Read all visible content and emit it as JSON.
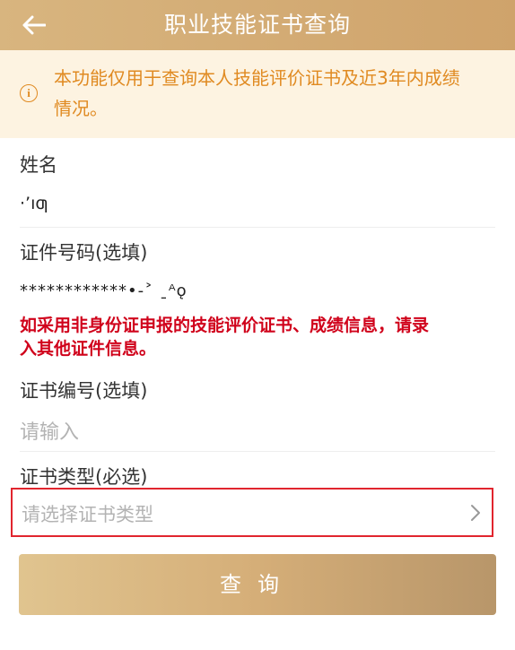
{
  "header": {
    "title": "职业技能证书查询",
    "back_icon": "arrow-left-icon"
  },
  "notice": {
    "icon": "info-circle-icon",
    "icon_glyph": "i",
    "text_line1": "本功能仅用于查询本人技能评价证书及近3年内成绩",
    "text_line2": "情况。"
  },
  "form": {
    "name_label": "姓名",
    "name_value": "·’ıƣ",
    "id_label": "证件号码(选填)",
    "id_value": "************•‐˃  ˍᴬǫ",
    "warning_line1": "如采用非身份证申报的技能评价证书、成绩信息，请录",
    "warning_line2": "入其他证件信息。",
    "cert_no_label": "证书编号(选填)",
    "cert_no_placeholder": "请输入",
    "cert_type_label": "证书类型(必选)",
    "cert_type_placeholder": "请选择证书类型",
    "chevron_icon": "chevron-right-icon"
  },
  "query_button": {
    "label": "查询"
  },
  "colors": {
    "header": "#d2a86f",
    "notice_bg": "#fdf3e1",
    "notice_text": "#e08a21",
    "warning": "#d0021b",
    "highlight_border": "#e1252e"
  }
}
